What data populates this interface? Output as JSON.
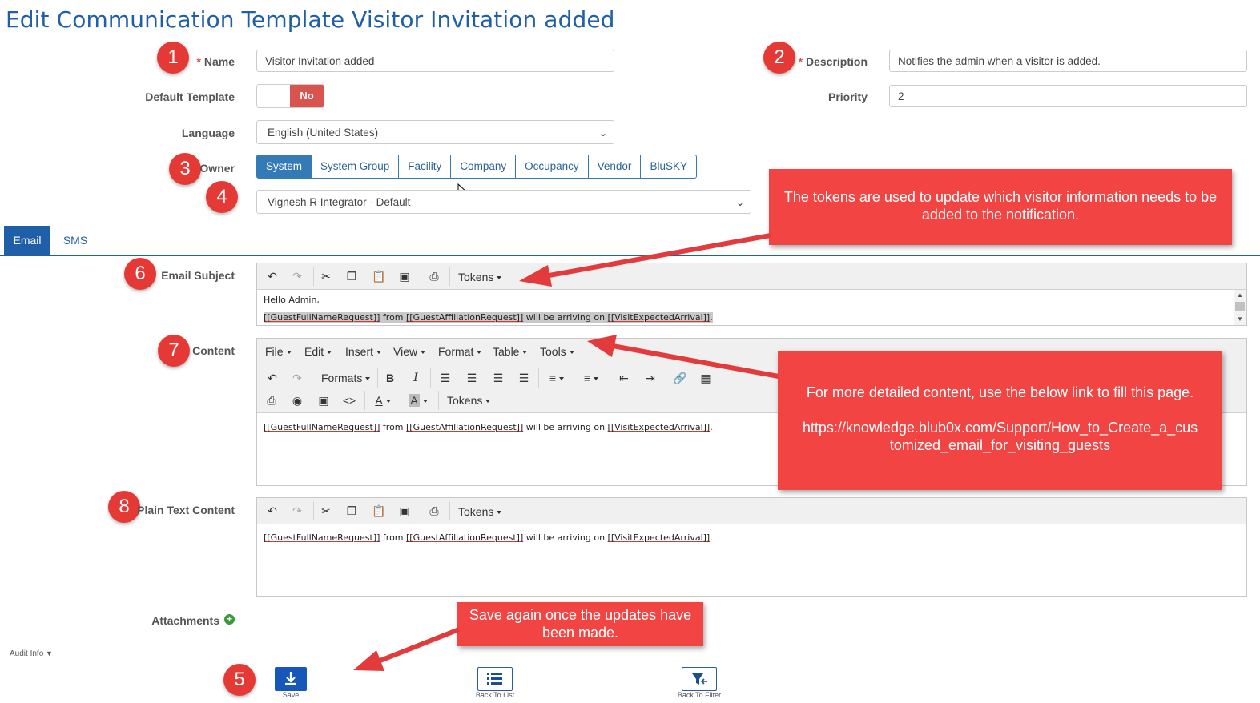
{
  "page": {
    "title": "Edit Communication Template Visitor Invitation added"
  },
  "form": {
    "name_label": "Name",
    "name_value": "Visitor Invitation added",
    "description_label": "Description",
    "description_value": "Notifies the admin when a visitor is added.",
    "default_template_label": "Default Template",
    "default_template_value": "No",
    "priority_label": "Priority",
    "priority_value": "2",
    "language_label": "Language",
    "language_value": "English (United States)",
    "owner_label": "Owner",
    "owner_options": [
      "System",
      "System Group",
      "Facility",
      "Company",
      "Occupancy",
      "Vendor",
      "BluSKY"
    ],
    "owner_selected": "System",
    "owner_entity_value": "Vignesh R Integrator - Default",
    "required_mark": "*"
  },
  "tabs": [
    "Email",
    "SMS"
  ],
  "email_subject": {
    "label": "Email Subject",
    "tokens_menu": "Tokens",
    "line1": "Hello Admin,",
    "line2": {
      "t1": "[[GuestFullNameRequest]]",
      "s1": " from ",
      "t2": "[[GuestAffiliationRequest]]",
      "s2": " will be arriving on ",
      "t3": "[[VisitExpectedArrival]]",
      "end": "."
    }
  },
  "content": {
    "label": "Content",
    "menus": [
      "File",
      "Edit",
      "Insert",
      "View",
      "Format",
      "Table",
      "Tools"
    ],
    "formats_menu": "Formats",
    "tokens_menu": "Tokens",
    "body": {
      "t1": "[[GuestFullNameRequest]]",
      "s1": " from ",
      "t2": "[[GuestAffiliationRequest]]",
      "s2": " will be arriving on ",
      "t3": "[[VisitExpectedArrival]]",
      "end": "."
    }
  },
  "plain_text": {
    "label": "Plain Text Content",
    "tokens_menu": "Tokens",
    "body": {
      "t1": "[[GuestFullNameRequest]]",
      "s1": " from ",
      "t2": "[[GuestAffiliationRequest]]",
      "s2": " will be arriving on ",
      "t3": "[[VisitExpectedArrival]]",
      "end": "."
    }
  },
  "attachments_label": "Attachments",
  "audit_info": "Audit Info",
  "buttons": {
    "save": "Save",
    "back_to_list": "Back To List",
    "back_to_filter": "Back To Filter"
  },
  "annotations": {
    "numbers": [
      "1",
      "2",
      "3",
      "4",
      "5",
      "6",
      "7",
      "8"
    ],
    "tokens_note": "The tokens are used to update which visitor information needs to be added to the notification.",
    "content_note": "For more detailed content, use the below link to fill this page.",
    "content_link_line1": "https://knowledge.blub0x.com/Support/How_to_Create_a_cus",
    "content_link_line2": "tomized_email_for_visiting_guests",
    "save_note": "Save again once the updates have been made."
  },
  "colors": {
    "title": "#1f5fa8",
    "primary": "#337ab7",
    "danger": "#d9534f",
    "callout": "#f24443"
  }
}
